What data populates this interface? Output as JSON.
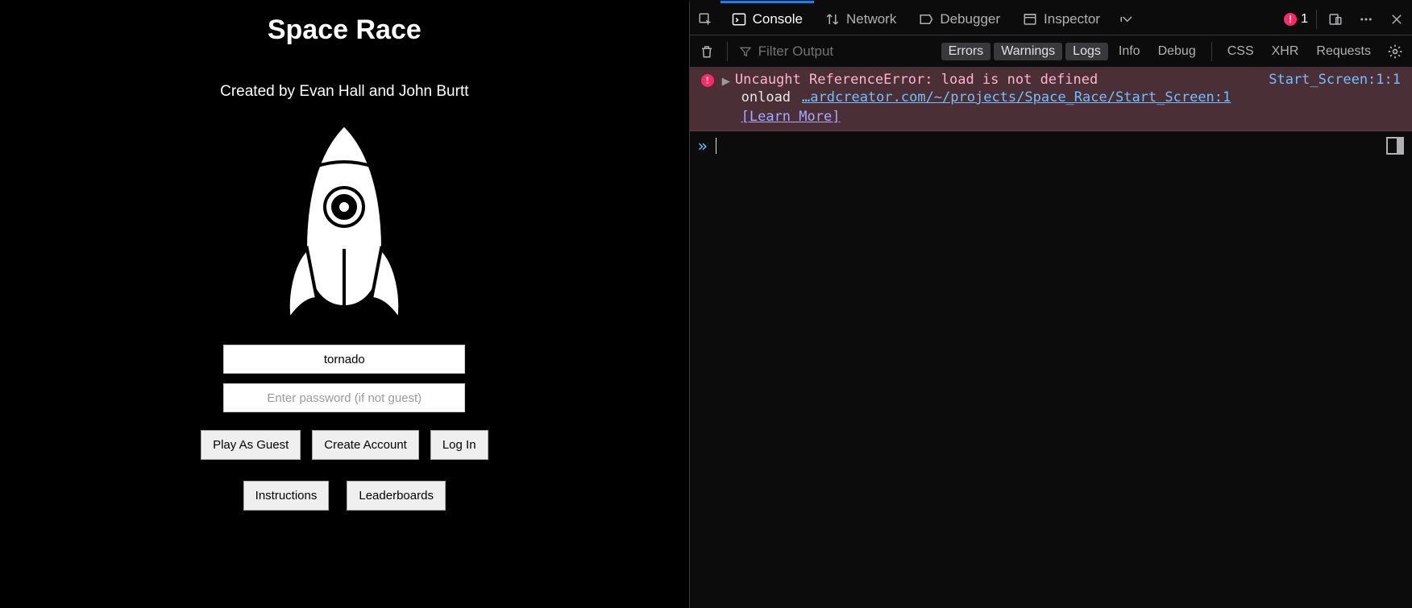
{
  "webpage": {
    "title": "Space Race",
    "subtitle": "Created by Evan Hall and John Burtt",
    "username_value": "tornado",
    "password_placeholder": "Enter password (if not guest)",
    "buttons": {
      "play_guest": "Play As Guest",
      "create_account": "Create Account",
      "log_in": "Log In",
      "instructions": "Instructions",
      "leaderboards": "Leaderboards"
    }
  },
  "devtools": {
    "tabs": {
      "console": "Console",
      "network": "Network",
      "debugger": "Debugger",
      "inspector": "Inspector"
    },
    "error_count": "1",
    "toolbar": {
      "filter_placeholder": "Filter Output",
      "filters": {
        "errors": "Errors",
        "warnings": "Warnings",
        "logs": "Logs",
        "info": "Info",
        "debug": "Debug",
        "css": "CSS",
        "xhr": "XHR",
        "requests": "Requests"
      }
    },
    "error": {
      "message": "Uncaught ReferenceError: load is not defined",
      "location": "Start_Screen:1:1",
      "stack_fn": "onload",
      "stack_loc": "…ardcreator.com/~/projects/Space_Race/Start_Screen:1",
      "learn_more": "[Learn More]"
    }
  }
}
